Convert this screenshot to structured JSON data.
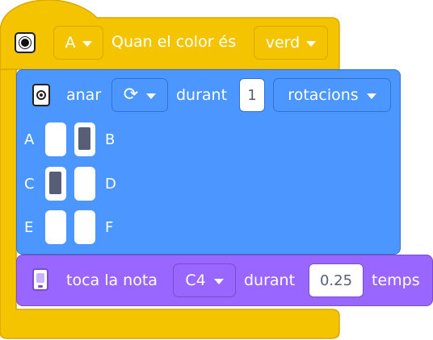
{
  "hat": {
    "port": "A",
    "label": "Quan el color és",
    "color_value": "verd"
  },
  "motor": {
    "verb": "anar",
    "direction_icon": "rotate-clockwise-icon",
    "during": "durant",
    "amount": "1",
    "unit": "rotacions",
    "ports": [
      {
        "letter": "A",
        "selected": false
      },
      {
        "letter": "B",
        "selected": true
      },
      {
        "letter": "C",
        "selected": true
      },
      {
        "letter": "D",
        "selected": false
      },
      {
        "letter": "E",
        "selected": false
      },
      {
        "letter": "F",
        "selected": false
      }
    ]
  },
  "sound": {
    "label": "toca la nota",
    "note": "C4",
    "during": "durant",
    "duration": "0.25",
    "unit": "temps"
  },
  "colors": {
    "events_yellow": "#f5c400",
    "events_border": "#d9a600",
    "motors_blue": "#4c97ff",
    "motors_border": "#3373cc",
    "sound_purple": "#9966ff",
    "sound_border": "#774dcb",
    "port_active": "#575e75"
  }
}
